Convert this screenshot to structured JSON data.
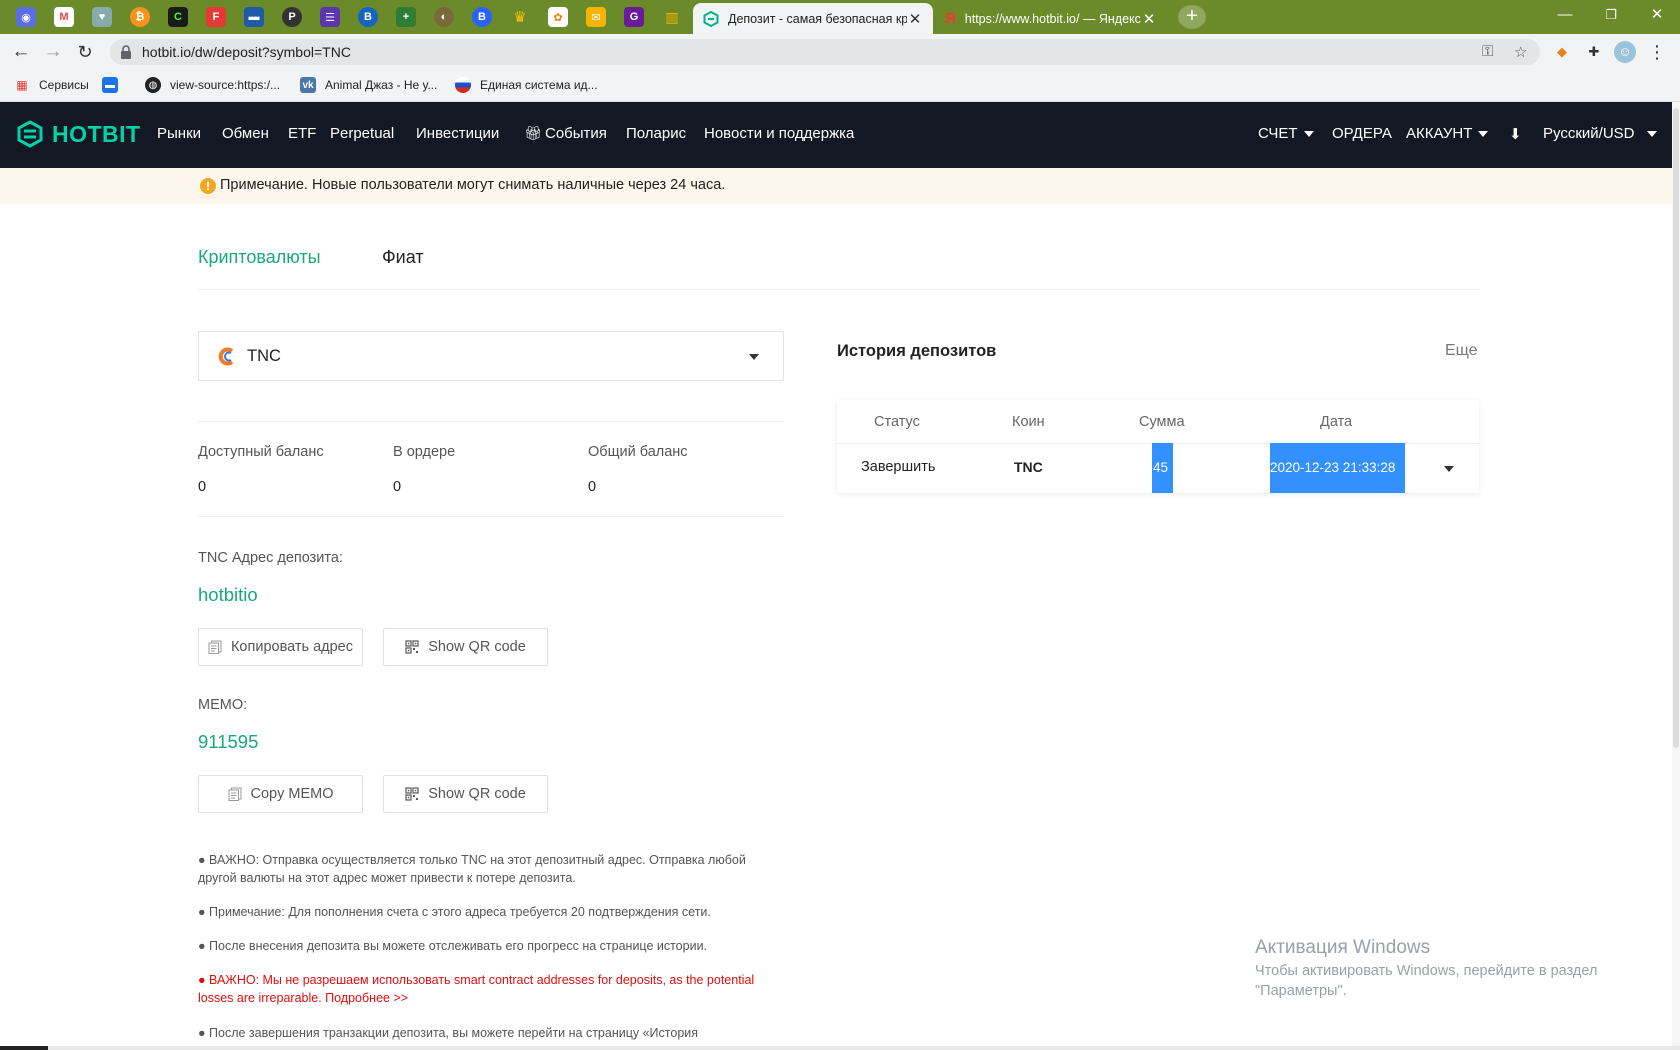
{
  "browser": {
    "tabs": [
      {
        "title": "Депозит - самая безопасная криптовалютная биржа",
        "active": true
      },
      {
        "title": "https://www.hotbit.io/ — Яндекс",
        "active": false
      }
    ],
    "url": "hotbit.io/dw/deposit?symbol=TNC",
    "bookmarks": [
      {
        "label": "Сервисы",
        "icon": "apps-grid-icon"
      },
      {
        "label": "",
        "icon": "chat-bubble-icon"
      },
      {
        "label": "view-source:https:/...",
        "icon": "globe-icon"
      },
      {
        "label": "Animal Джаз - Не у...",
        "icon": "vk-icon"
      },
      {
        "label": "Единая система ид...",
        "icon": "russia-flag-icon"
      }
    ]
  },
  "site": {
    "logo_text": "HOTBIT",
    "nav": [
      "Рынки",
      "Обмен",
      "ETF",
      "Perpetual",
      "Инвестиции",
      "События",
      "Поларис",
      "Новости и поддержка"
    ],
    "right_nav": {
      "account_menu": "СЧЕТ",
      "orders": "ОРДЕРА",
      "profile": "АККАУНТ",
      "language": "Русский/USD"
    },
    "colors": {
      "brand": "#00d3a7",
      "header_bg": "#121824",
      "accent_green": "#17a97a",
      "warning_red": "#e10e0e"
    }
  },
  "notice": {
    "text": "Примечание. Новые пользователи могут снимать наличные через 24 часа."
  },
  "page_tabs": {
    "crypto": "Криптовалюты",
    "fiat": "Фиат"
  },
  "deposit": {
    "coin": "TNC",
    "balances": [
      {
        "label": "Доступный баланс",
        "value": "0"
      },
      {
        "label": "В ордере",
        "value": "0"
      },
      {
        "label": "Общий баланс",
        "value": "0"
      }
    ],
    "address_label": "TNC Адрес депозита:",
    "address": "hotbitio",
    "copy_address_btn": "Копировать адрес",
    "qr_btn": "Show QR code",
    "memo_label": "MEMO:",
    "memo": "911595",
    "copy_memo_btn": "Copy MEMO",
    "notes": [
      "● ВАЖНО: Отправка осуществляется только TNC на этот депозитный адрес. Отправка любой другой валюты на этот адрес может привести к потере депозита.",
      "● Примечание: Для пополнения счета с этого адреса требуется 20 подтверждения сети.",
      "● После внесения депозита вы можете отслеживать его прогресс на странице истории.",
      "● ВАЖНО: Мы не разрешаем использовать smart contract addresses for deposits, as the potential losses are irreparable. Подробнее >>",
      "● После завершения транзакции депозита, вы можете перейти на страницу «История"
    ]
  },
  "history": {
    "title": "История депозитов",
    "more": "Еще",
    "columns": [
      "Статус",
      "Коин",
      "Сумма",
      "Дата"
    ],
    "rows": [
      {
        "status": "Завершить",
        "coin": "TNC",
        "amount": "45",
        "date": "2020-12-23 21:33:28"
      }
    ]
  },
  "watermark": {
    "title": "Активация Windows",
    "text": "Чтобы активировать Windows, перейдите в раздел \"Параметры\"."
  }
}
